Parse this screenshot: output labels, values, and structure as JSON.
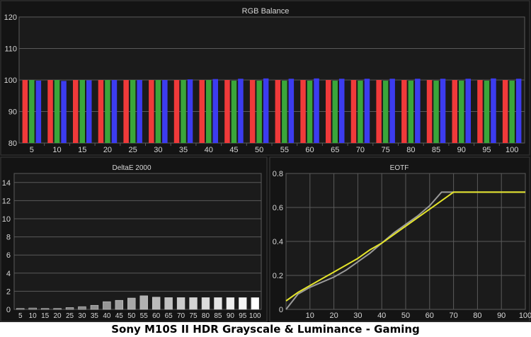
{
  "caption": "Sony M10S II HDR Grayscale & Luminance - Gaming",
  "colors": {
    "background": "#141414",
    "plot_bg": "#1b1b1b",
    "grid": "#5a5a5a",
    "text": "#d6d6d6",
    "red": "#f03a3a",
    "green": "#3aa63a",
    "blue": "#3c3cf0",
    "eotf_measured": "#e4e42a",
    "eotf_target": "#9a9a9a"
  },
  "chart_data": [
    {
      "id": "rgb",
      "type": "bar",
      "title": "RGB Balance",
      "categories": [
        "5",
        "10",
        "15",
        "20",
        "25",
        "30",
        "35",
        "40",
        "45",
        "50",
        "55",
        "60",
        "65",
        "70",
        "75",
        "80",
        "85",
        "90",
        "95",
        "100"
      ],
      "ylim": [
        80,
        120
      ],
      "yticks": [
        80,
        90,
        100,
        110,
        120
      ],
      "grid": true,
      "series": [
        {
          "color": "red",
          "values": [
            100,
            100,
            100,
            100,
            100,
            100,
            100,
            100,
            100,
            100,
            100,
            100,
            100,
            100,
            100,
            100,
            100,
            100,
            100,
            100
          ]
        },
        {
          "color": "green",
          "values": [
            100,
            100,
            100,
            100,
            100,
            100,
            100,
            100,
            99.8,
            99.8,
            99.8,
            99.8,
            99.8,
            99.8,
            99.8,
            99.8,
            99.8,
            99.8,
            99.8,
            99.8
          ]
        },
        {
          "color": "blue",
          "values": [
            99.8,
            99.7,
            99.9,
            100,
            100,
            100,
            100.2,
            100.3,
            100.4,
            100.5,
            100.4,
            100.5,
            100.4,
            100.4,
            100.4,
            100.4,
            100.4,
            100.4,
            100.5,
            100.4
          ]
        }
      ]
    },
    {
      "id": "deltae",
      "type": "bar",
      "title": "DeltaE 2000",
      "categories": [
        "5",
        "10",
        "15",
        "20",
        "25",
        "30",
        "35",
        "40",
        "45",
        "50",
        "55",
        "60",
        "65",
        "70",
        "75",
        "80",
        "85",
        "90",
        "95",
        "100"
      ],
      "values": [
        0.1,
        0.15,
        0.1,
        0.1,
        0.2,
        0.3,
        0.45,
        0.85,
        1.0,
        1.25,
        1.5,
        1.35,
        1.3,
        1.3,
        1.3,
        1.3,
        1.3,
        1.3,
        1.3,
        1.3
      ],
      "ylim": [
        0,
        15
      ],
      "yticks": [
        0,
        2,
        4,
        6,
        8,
        10,
        12,
        14
      ],
      "grid": true
    },
    {
      "id": "eotf",
      "type": "line",
      "title": "EOTF",
      "xlim": [
        0,
        100
      ],
      "ylim": [
        0,
        0.8
      ],
      "xticks": [
        10,
        20,
        30,
        40,
        50,
        60,
        70,
        80,
        90,
        100
      ],
      "yticks": [
        0,
        0.2,
        0.4,
        0.6,
        0.8
      ],
      "grid": true,
      "series": [
        {
          "color": "eotf_target",
          "x": [
            0,
            5,
            10,
            15,
            20,
            25,
            30,
            35,
            40,
            45,
            50,
            55,
            60,
            65,
            70,
            75,
            80,
            85,
            90,
            95,
            100
          ],
          "y": [
            0.0,
            0.09,
            0.13,
            0.16,
            0.19,
            0.23,
            0.28,
            0.33,
            0.39,
            0.45,
            0.5,
            0.55,
            0.61,
            0.69,
            0.69,
            0.69,
            0.69,
            0.69,
            0.69,
            0.69,
            0.69
          ]
        },
        {
          "color": "eotf_measured",
          "x": [
            0,
            5,
            10,
            15,
            20,
            25,
            30,
            35,
            40,
            45,
            50,
            55,
            60,
            65,
            70,
            75,
            80,
            85,
            90,
            95,
            100
          ],
          "y": [
            0.05,
            0.1,
            0.14,
            0.18,
            0.22,
            0.26,
            0.3,
            0.35,
            0.39,
            0.44,
            0.49,
            0.54,
            0.59,
            0.64,
            0.69,
            0.69,
            0.69,
            0.69,
            0.69,
            0.69,
            0.69
          ]
        }
      ]
    }
  ]
}
